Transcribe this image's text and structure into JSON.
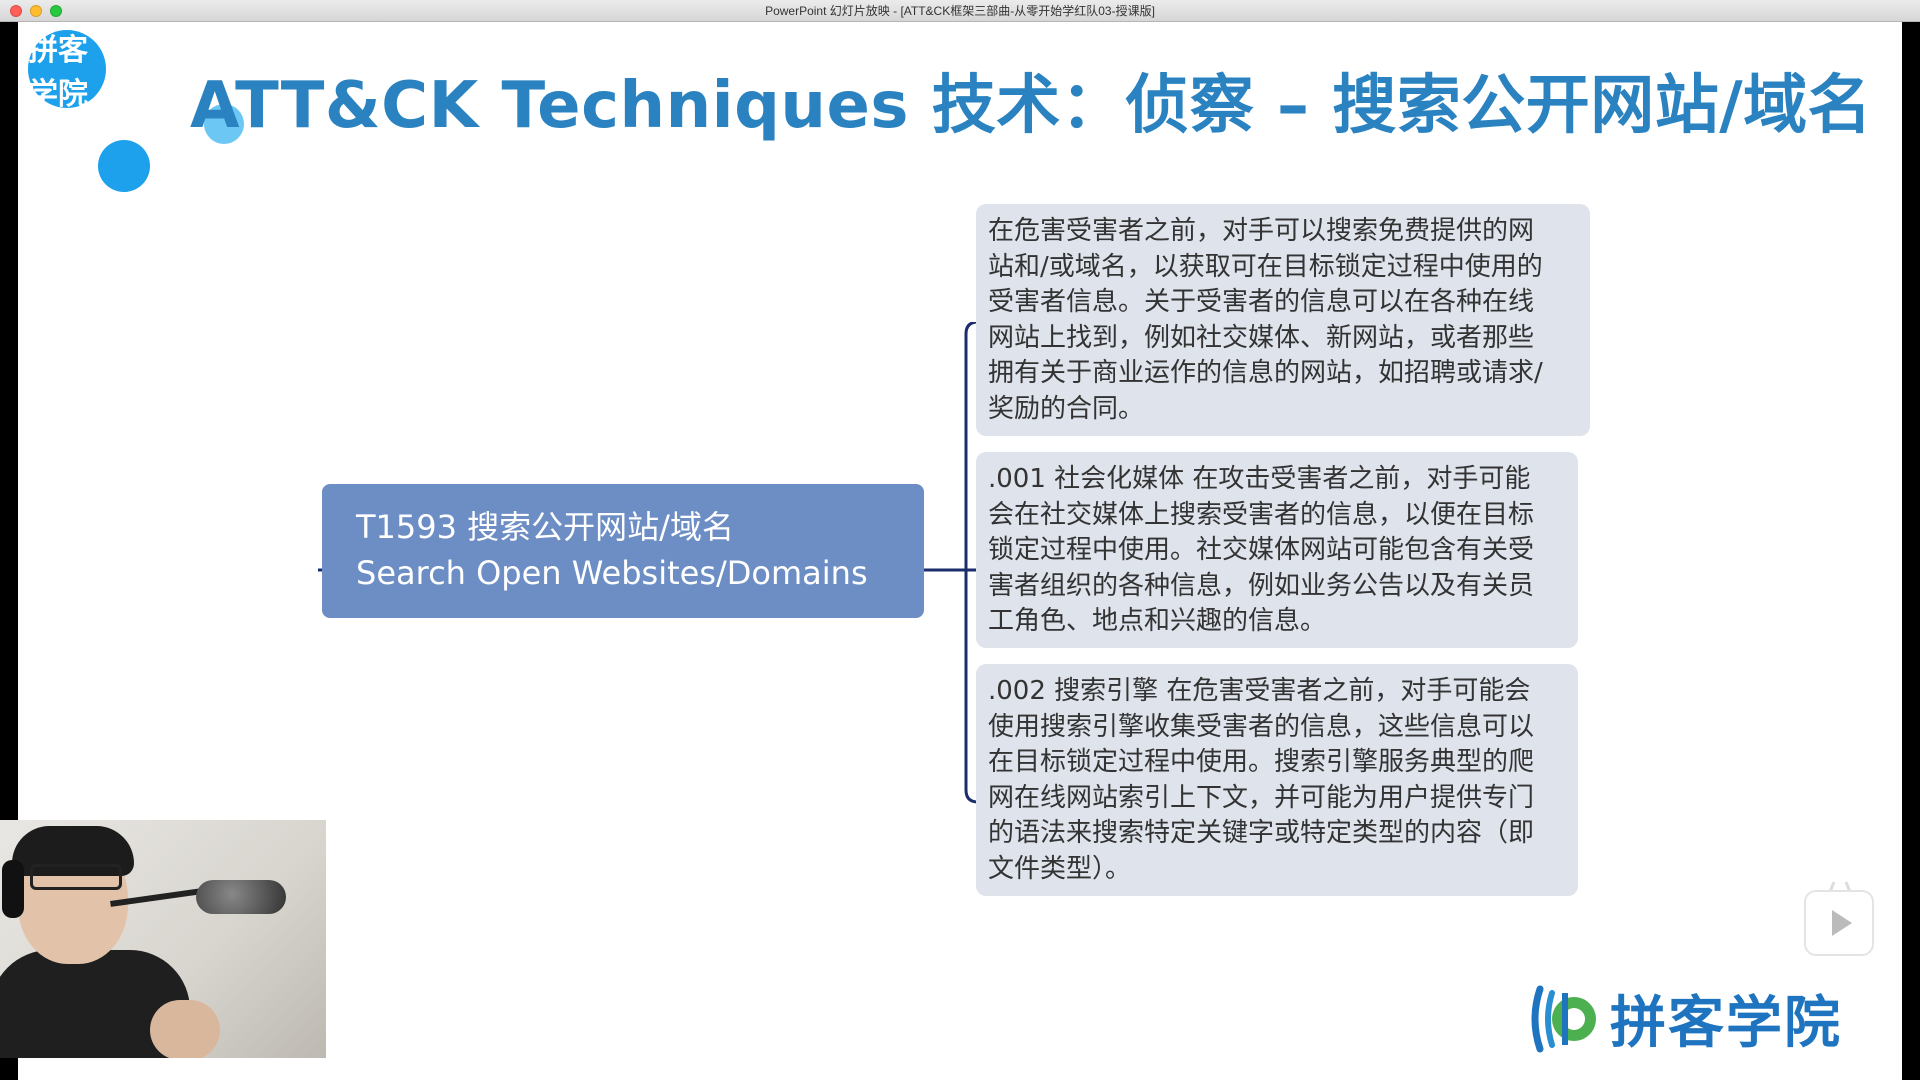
{
  "window": {
    "title": "PowerPoint 幻灯片放映 - [ATT&CK框架三部曲-从零开始学红队03-授课版]"
  },
  "slide": {
    "watermark": "拼客学院",
    "title": "ATT&CK Techniques 技术：侦察 – 搜索公开网站/域名",
    "technique": {
      "line1": "T1593 搜索公开网站/域名",
      "line2": "Search Open Websites/Domains"
    },
    "boxes": [
      {
        "lines": [
          "在危害受害者之前，对手可以搜索免费提供的网",
          "站和/或域名，以获取可在目标锁定过程中使用的",
          "受害者信息。关于受害者的信息可以在各种在线",
          "网站上找到，例如社交媒体、新网站，或者那些",
          "拥有关于商业运作的信息的网站，如招聘或请求/",
          "奖励的合同。"
        ]
      },
      {
        "lines": [
          ".001 社会化媒体 在攻击受害者之前，对手可能",
          "会在社交媒体上搜索受害者的信息，以便在目标",
          "锁定过程中使用。社交媒体网站可能包含有关受",
          "害者组织的各种信息，例如业务公告以及有关员",
          "工角色、地点和兴趣的信息。"
        ]
      },
      {
        "lines": [
          ".002 搜索引擎 在危害受害者之前，对手可能会",
          "使用搜索引擎收集受害者的信息，这些信息可以",
          "在目标锁定过程中使用。搜索引擎服务典型的爬",
          "网在线网站索引上下文，并可能为用户提供专门",
          "的语法来搜索特定关键字或特定类型的内容（即",
          "文件类型）。"
        ]
      }
    ],
    "logo_text": "拼客学院"
  },
  "colors": {
    "title": "#2a83c0",
    "node": "#6d8ec5",
    "box": "#dee3ec",
    "bracket": "#1c2d6e",
    "accent_circle": "#1da1ec"
  }
}
